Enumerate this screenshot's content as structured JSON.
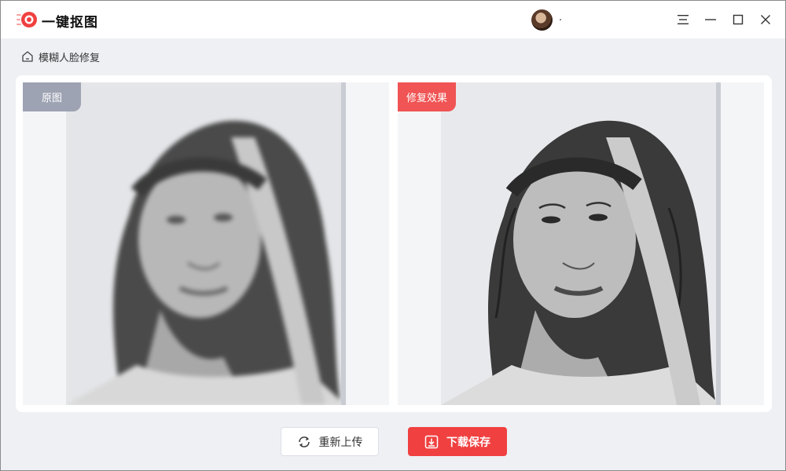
{
  "app": {
    "title": "一键抠图",
    "brand_color": "#f04040"
  },
  "user": {
    "name": ".",
    "avatar_icon": "user-avatar"
  },
  "window_controls": [
    "menu-icon",
    "minimize-icon",
    "maximize-icon",
    "close-icon"
  ],
  "breadcrumb": {
    "icon": "home-icon",
    "label": "模糊人脸修复"
  },
  "compare": {
    "original_label": "原图",
    "result_label": "修复效果",
    "original_tag_color": "#9ea3b3",
    "result_tag_color": "#f05454"
  },
  "actions": {
    "reupload_label": "重新上传",
    "download_label": "下载保存"
  }
}
